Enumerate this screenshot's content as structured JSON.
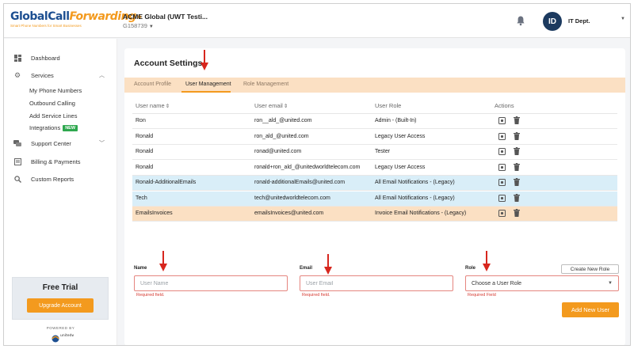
{
  "brand": {
    "logo_text_a": "Global",
    "logo_text_b": "Call",
    "logo_text_c": "Forwarding",
    "tagline": "Smart Phone Numbers for Smart Businesses",
    "accent_color": "#f39a1e",
    "primary_color": "#1d4f91"
  },
  "header": {
    "account_name": "ACME Global (UWT Testi...",
    "account_id": "G158739",
    "avatar_initials": "ID",
    "user_name": "IT Dept."
  },
  "sidebar": {
    "items": [
      {
        "label": "Dashboard",
        "icon": "dashboard-icon"
      },
      {
        "label": "Services",
        "icon": "gear-icon"
      },
      {
        "label": "Support Center",
        "icon": "chat-icon"
      },
      {
        "label": "Billing & Payments",
        "icon": "billing-icon"
      },
      {
        "label": "Custom Reports",
        "icon": "search-icon"
      }
    ],
    "services_sub": [
      "My Phone Numbers",
      "Outbound Calling",
      "Add Service Lines",
      "Integrations"
    ],
    "new_badge": "NEW",
    "trial_title": "Free Trial",
    "upgrade_label": "Upgrade Account",
    "powered_by": "POWERED BY",
    "partner_logo_text": "unitedworld"
  },
  "page": {
    "title": "Account Settings",
    "tabs": [
      "Account Profile",
      "User Management",
      "Role Management"
    ],
    "active_tab": "User Management"
  },
  "table": {
    "columns": [
      "User name",
      "User email",
      "User Role",
      "Actions"
    ],
    "rows": [
      {
        "name": "Ron",
        "email": "ron__ald_@united.com",
        "role": "Admin - (Built-In)"
      },
      {
        "name": "Ronald",
        "email": "ron_ald_@united.com",
        "role": "Legacy User Access"
      },
      {
        "name": "Ronald",
        "email": "ronad@united.com",
        "role": "Tester"
      },
      {
        "name": "Ronald",
        "email": "ronald+ron_ald_@unitedworldtelecom.com",
        "role": "Legacy User Access"
      },
      {
        "name": "Ronald-AdditionalEmails",
        "email": "ronald-additionalEmails@united.com",
        "role": "All Email Notifications - (Legacy)"
      },
      {
        "name": "Tech",
        "email": "tech@unitedworldtelecom.com",
        "role": "All Email Notifications - (Legacy)"
      },
      {
        "name": "EmailsInvoices",
        "email": "emailsInvoices@united.com",
        "role": "Invoice Email Notifications - (Legacy)"
      }
    ]
  },
  "form": {
    "name_label": "Name",
    "name_placeholder": "User Name",
    "name_error": "Required field.",
    "email_label": "Email",
    "email_placeholder": "User Email",
    "email_error": "Required field.",
    "role_label": "Role",
    "role_placeholder": "Choose a User Role",
    "role_error": "Required Field",
    "create_role_label": "Create New Role",
    "add_user_label": "Add New User"
  }
}
